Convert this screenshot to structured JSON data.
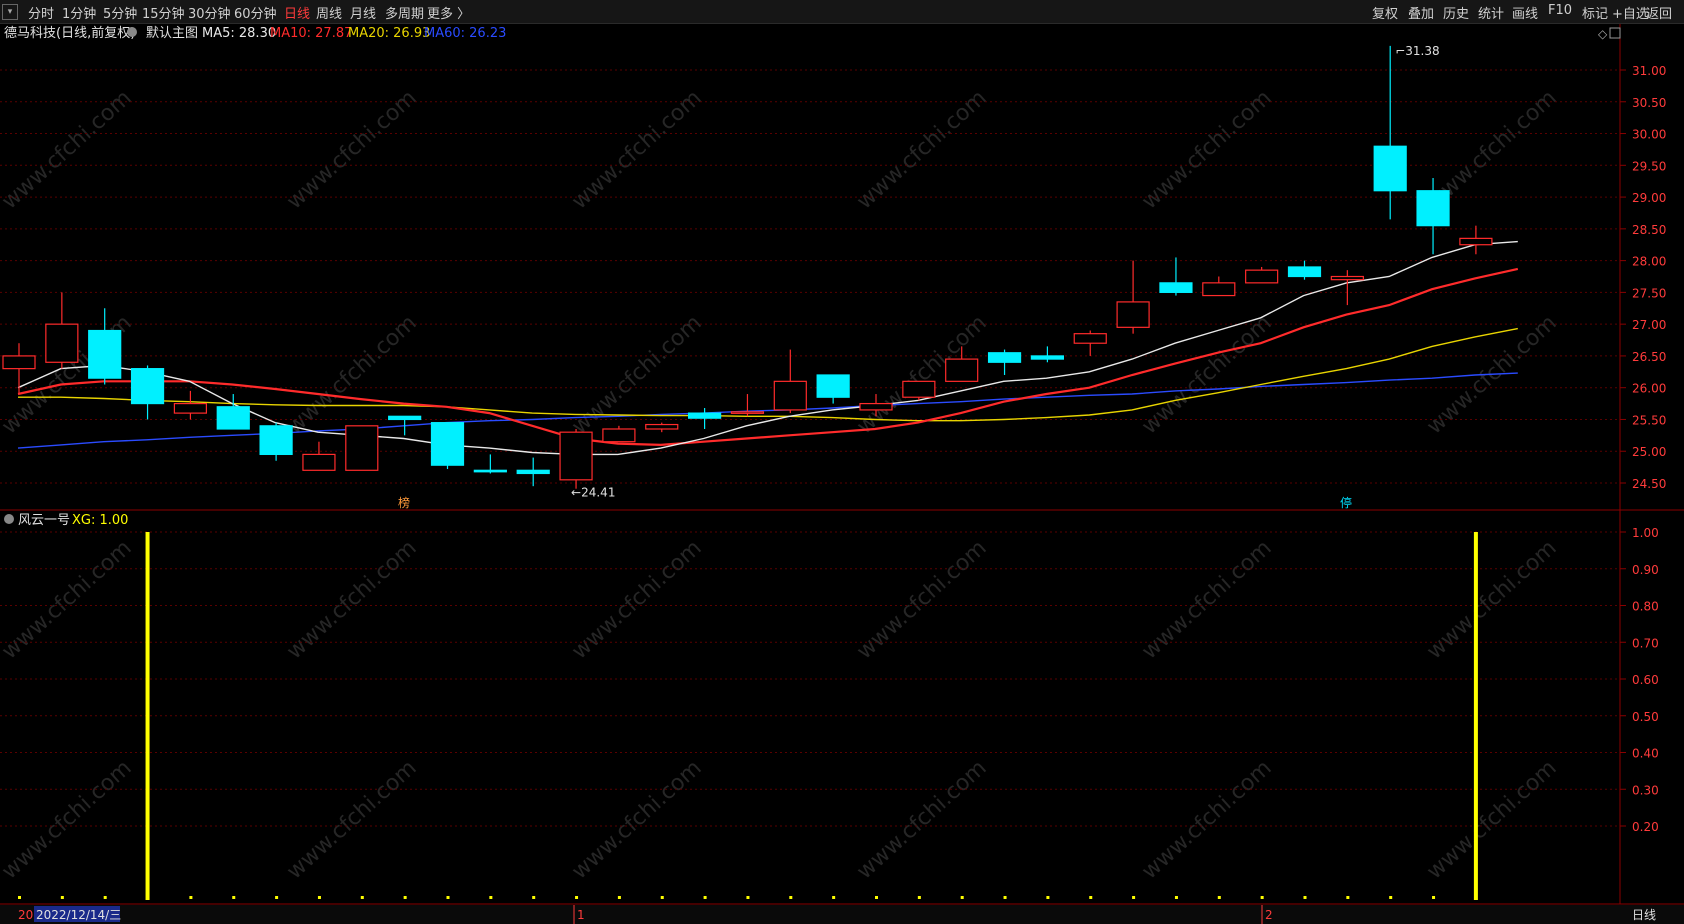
{
  "toolbar": {
    "periods": [
      "分时",
      "1分钟",
      "5分钟",
      "15分钟",
      "30分钟",
      "60分钟",
      "日线",
      "周线",
      "月线",
      "多周期",
      "更多 〉"
    ],
    "active_period": "日线",
    "tools": [
      "复权",
      "叠加",
      "历史",
      "统计",
      "画线",
      "F10",
      "标记",
      "+自选",
      "返回"
    ]
  },
  "main_panel": {
    "stock_title": "德马科技(日线,前复权)",
    "indicator_name": "默认主图",
    "ma_labels": [
      {
        "text": "MA5: 28.30",
        "color": "#e8e8e8"
      },
      {
        "text": "MA10: 27.87",
        "color": "#ff2b2b"
      },
      {
        "text": "MA20: 26.93",
        "color": "#e8d400"
      },
      {
        "text": "MA60: 26.23",
        "color": "#2a4bff"
      }
    ],
    "price_axis_labels": [
      "31.00",
      "30.50",
      "30.00",
      "29.50",
      "29.00",
      "28.50",
      "28.00",
      "27.50",
      "27.00",
      "26.50",
      "26.00",
      "25.50",
      "25.00",
      "24.50"
    ],
    "high_label": "31.38",
    "low_label": "24.41",
    "markers": [
      "榜",
      "停"
    ]
  },
  "sub_panel": {
    "indicator_name": "风云一号",
    "xg_label": "XG: 1.00",
    "axis_labels": [
      "1.00",
      "0.90",
      "0.80",
      "0.70",
      "0.60",
      "0.50",
      "0.40",
      "0.30",
      "0.20"
    ]
  },
  "bottom_bar": {
    "year_marker": "20",
    "date_label": "2022/12/14/三",
    "month_markers": [
      "1",
      "2"
    ],
    "period_label": "日线"
  },
  "watermark": "www.cfchi.com",
  "colors": {
    "up": "#ff2b2b",
    "down": "#00f0ff",
    "ma5": "#e8e8e8",
    "ma10": "#ff2b2b",
    "ma20": "#e8d400",
    "ma60": "#2a4bff",
    "signal": "#ffff00"
  },
  "chart_data": {
    "type": "candlestick",
    "y_range": [
      24.2,
      31.4
    ],
    "candles": [
      {
        "o": 26.3,
        "h": 26.7,
        "l": 25.9,
        "c": 26.5
      },
      {
        "o": 26.4,
        "h": 27.5,
        "l": 26.3,
        "c": 27.0
      },
      {
        "o": 26.9,
        "h": 27.25,
        "l": 26.05,
        "c": 26.15
      },
      {
        "o": 26.3,
        "h": 26.35,
        "l": 25.5,
        "c": 25.75
      },
      {
        "o": 25.6,
        "h": 25.95,
        "l": 25.5,
        "c": 25.75
      },
      {
        "o": 25.7,
        "h": 25.9,
        "l": 25.35,
        "c": 25.35
      },
      {
        "o": 25.4,
        "h": 25.45,
        "l": 24.85,
        "c": 24.95
      },
      {
        "o": 24.7,
        "h": 25.15,
        "l": 24.7,
        "c": 24.95
      },
      {
        "o": 24.7,
        "h": 25.4,
        "l": 24.7,
        "c": 25.4
      },
      {
        "o": 25.55,
        "h": 25.55,
        "l": 25.25,
        "c": 25.5
      },
      {
        "o": 25.45,
        "h": 25.45,
        "l": 24.72,
        "c": 24.78
      },
      {
        "o": 24.7,
        "h": 24.95,
        "l": 24.65,
        "c": 24.68
      },
      {
        "o": 24.7,
        "h": 24.9,
        "l": 24.45,
        "c": 24.65
      },
      {
        "o": 24.55,
        "h": 25.35,
        "l": 24.41,
        "c": 25.3
      },
      {
        "o": 25.15,
        "h": 25.4,
        "l": 25.15,
        "c": 25.35
      },
      {
        "o": 25.35,
        "h": 25.45,
        "l": 25.3,
        "c": 25.42
      },
      {
        "o": 25.6,
        "h": 25.68,
        "l": 25.35,
        "c": 25.52
      },
      {
        "o": 25.6,
        "h": 25.9,
        "l": 25.55,
        "c": 25.62
      },
      {
        "o": 25.65,
        "h": 26.6,
        "l": 25.6,
        "c": 26.1
      },
      {
        "o": 26.2,
        "h": 26.2,
        "l": 25.75,
        "c": 25.85
      },
      {
        "o": 25.65,
        "h": 25.9,
        "l": 25.55,
        "c": 25.75
      },
      {
        "o": 25.85,
        "h": 26.1,
        "l": 25.8,
        "c": 26.1
      },
      {
        "o": 26.1,
        "h": 26.65,
        "l": 26.1,
        "c": 26.45
      },
      {
        "o": 26.55,
        "h": 26.6,
        "l": 26.2,
        "c": 26.4
      },
      {
        "o": 26.5,
        "h": 26.65,
        "l": 26.4,
        "c": 26.45
      },
      {
        "o": 26.7,
        "h": 26.9,
        "l": 26.5,
        "c": 26.85
      },
      {
        "o": 26.95,
        "h": 28.0,
        "l": 26.85,
        "c": 27.35
      },
      {
        "o": 27.65,
        "h": 28.05,
        "l": 27.45,
        "c": 27.5
      },
      {
        "o": 27.45,
        "h": 27.75,
        "l": 27.45,
        "c": 27.65
      },
      {
        "o": 27.65,
        "h": 27.9,
        "l": 27.65,
        "c": 27.85
      },
      {
        "o": 27.9,
        "h": 28.0,
        "l": 27.7,
        "c": 27.75
      },
      {
        "o": 27.7,
        "h": 27.85,
        "l": 27.3,
        "c": 27.75
      },
      {
        "o": 29.8,
        "h": 31.38,
        "l": 28.65,
        "c": 29.1
      },
      {
        "o": 29.1,
        "h": 29.3,
        "l": 28.1,
        "c": 28.55
      },
      {
        "o": 28.25,
        "h": 28.55,
        "l": 28.1,
        "c": 28.35
      }
    ],
    "ma5": [
      26.0,
      26.3,
      26.35,
      26.25,
      26.1,
      25.75,
      25.45,
      25.3,
      25.25,
      25.2,
      25.1,
      25.05,
      24.98,
      24.95,
      24.95,
      25.05,
      25.2,
      25.4,
      25.55,
      25.65,
      25.72,
      25.8,
      25.95,
      26.1,
      26.15,
      26.25,
      26.45,
      26.7,
      26.9,
      27.1,
      27.45,
      27.65,
      27.75,
      28.05,
      28.25,
      28.3
    ],
    "ma10": [
      25.9,
      26.05,
      26.1,
      26.1,
      26.1,
      26.05,
      25.98,
      25.9,
      25.82,
      25.75,
      25.7,
      25.6,
      25.4,
      25.2,
      25.12,
      25.1,
      25.15,
      25.2,
      25.25,
      25.3,
      25.35,
      25.45,
      25.6,
      25.78,
      25.9,
      26.0,
      26.2,
      26.38,
      26.55,
      26.7,
      26.95,
      27.15,
      27.3,
      27.55,
      27.72,
      27.87
    ],
    "ma20": [
      25.85,
      25.85,
      25.83,
      25.8,
      25.78,
      25.75,
      25.73,
      25.72,
      25.72,
      25.72,
      25.7,
      25.65,
      25.6,
      25.58,
      25.57,
      25.56,
      25.56,
      25.55,
      25.55,
      25.53,
      25.5,
      25.48,
      25.48,
      25.5,
      25.53,
      25.57,
      25.65,
      25.8,
      25.92,
      26.05,
      26.18,
      26.3,
      26.45,
      26.65,
      26.8,
      26.93
    ],
    "ma60": [
      25.05,
      25.1,
      25.15,
      25.18,
      25.22,
      25.25,
      25.28,
      25.32,
      25.35,
      25.4,
      25.45,
      25.48,
      25.5,
      25.53,
      25.55,
      25.58,
      25.6,
      25.63,
      25.65,
      25.68,
      25.72,
      25.75,
      25.78,
      25.82,
      25.85,
      25.88,
      25.9,
      25.95,
      25.98,
      26.02,
      26.05,
      26.08,
      26.12,
      26.15,
      26.2,
      26.23
    ],
    "signal_bars": [
      3,
      34
    ],
    "xg_values": [
      1.0
    ]
  }
}
